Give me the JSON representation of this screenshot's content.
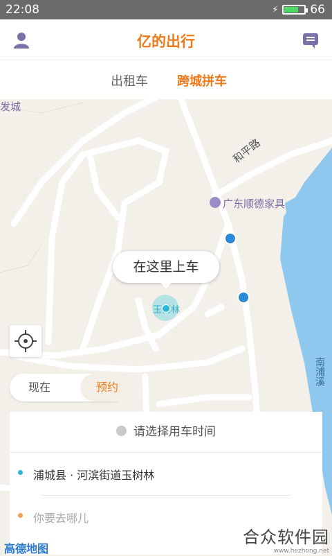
{
  "status": {
    "time": "22:08",
    "battery": "66"
  },
  "app": {
    "title": "亿的出行"
  },
  "tabs": [
    {
      "label": "出租车",
      "active": false
    },
    {
      "label": "跨城拼车",
      "active": true
    }
  ],
  "map": {
    "labels": {
      "poi_top_left": "发城",
      "road": "和平路",
      "poi_store": "广东顺德家具",
      "river": "南浦溪",
      "current_place": "玉树林"
    },
    "pickup_bubble": "在这里上车",
    "provider_logo": "高德地图"
  },
  "time_mode": {
    "now": "现在",
    "reserve": "预约",
    "selected": "reserve"
  },
  "booking": {
    "time_prompt": "请选择用车时间",
    "origin": "浦城县 · 河滨街道玉树林",
    "destination_placeholder": "你要去哪儿"
  },
  "watermark": {
    "text": "合众软件园",
    "url": "www.hezhong.net"
  },
  "colors": {
    "accent": "#f07a1a",
    "origin_dot": "#2ab7d6",
    "dest_dot": "#f0a050",
    "water": "#8fc8ee"
  }
}
